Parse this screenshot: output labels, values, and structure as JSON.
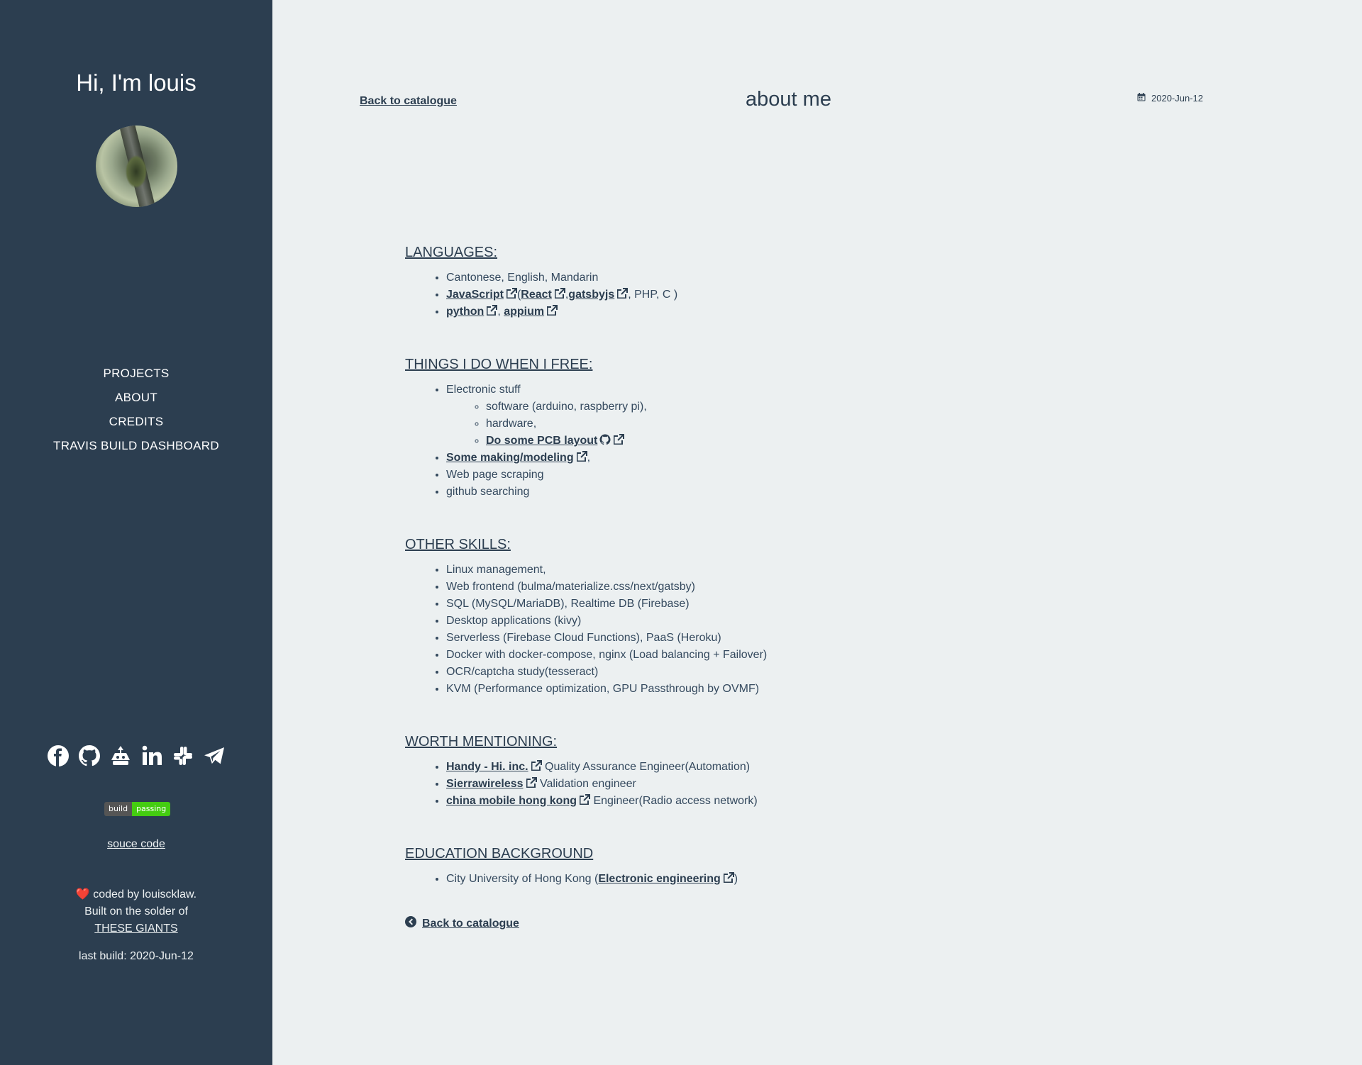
{
  "sidebar": {
    "title": "Hi, I'm louis",
    "nav": [
      "PROJECTS",
      "ABOUT",
      "CREDITS",
      "TRAVIS BUILD DASHBOARD"
    ],
    "social_icons": [
      "facebook-icon",
      "github-icon",
      "toolbox-icon",
      "linkedin-icon",
      "slack-icon",
      "telegram-icon"
    ],
    "badge": {
      "left": "build",
      "right": "passing",
      "right_color": "#44cc11"
    },
    "source_link": "souce code",
    "credit_line1": "coded by louiscklaw.",
    "credit_line2": "Built on the solder of",
    "credit_link": "THESE GIANTS",
    "last_build": "last build: 2020-Jun-12"
  },
  "header": {
    "back_link": "Back to catalogue",
    "title": "about me",
    "date": "2020-Jun-12"
  },
  "sections": {
    "languages": {
      "heading": "LANGUAGES:",
      "item1": "Cantonese, English, Mandarin",
      "js": "JavaScript",
      "react": "React",
      "gatsby": "gatsbyjs",
      "js_rest": ", PHP, C )",
      "python": "python",
      "appium": "appium"
    },
    "free": {
      "heading": "THINGS I DO WHEN I FREE:",
      "electronic": "Electronic stuff",
      "software": "software (arduino, raspberry pi),",
      "hardware": "hardware,",
      "pcb": "Do some PCB layout",
      "making": "Some making/modeling",
      "scraping": "Web page scraping",
      "github": "github searching"
    },
    "skills": {
      "heading": "OTHER SKILLS:",
      "items": [
        "Linux management,",
        "Web frontend (bulma/materialize.css/next/gatsby)",
        "SQL (MySQL/MariaDB), Realtime DB (Firebase)",
        "Desktop applications (kivy)",
        "Serverless (Firebase Cloud Functions), PaaS (Heroku)",
        "Docker with docker-compose, nginx (Load balancing + Failover)",
        "OCR/captcha study(tesseract)",
        "KVM (Performance optimization, GPU Passthrough by OVMF)"
      ]
    },
    "worth": {
      "heading": "WORTH MENTIONING:",
      "handy": "Handy - Hi. inc.",
      "handy_role": "Quality Assurance Engineer(Automation)",
      "sierra": "Sierrawireless",
      "sierra_role": "Validation engineer",
      "cmhk": "china mobile hong kong",
      "cmhk_role": "Engineer(Radio access network)"
    },
    "education": {
      "heading": "EDUCATION BACKGROUND",
      "school": "City University of Hong Kong (",
      "major": "Electronic engineering",
      "close": ")"
    }
  },
  "footer_back": "Back to catalogue"
}
